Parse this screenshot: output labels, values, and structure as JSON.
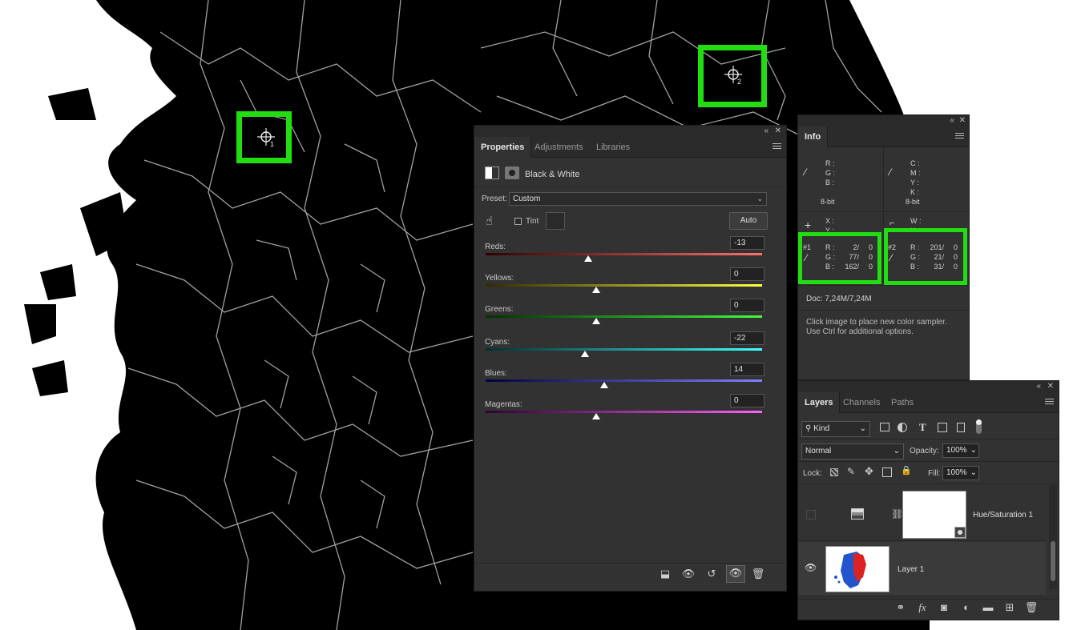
{
  "colors": {
    "accent": "#22dd11",
    "panel_bg": "#323232"
  },
  "map": {
    "sampler1_label": "1",
    "sampler2_label": "2"
  },
  "properties": {
    "tabs": [
      "Properties",
      "Adjustments",
      "Libraries"
    ],
    "adjustment_name": "Black & White",
    "preset_label": "Preset:",
    "preset_value": "Custom",
    "tint_label": "Tint",
    "auto_label": "Auto",
    "sliders": [
      {
        "label": "Reds:",
        "value": "-13",
        "colors": [
          "#300000",
          "#ff7070"
        ],
        "position": 0.37
      },
      {
        "label": "Yellows:",
        "value": "0",
        "colors": [
          "#302a00",
          "#ffff40"
        ],
        "position": 0.4
      },
      {
        "label": "Greens:",
        "value": "0",
        "colors": [
          "#003000",
          "#40ff40"
        ],
        "position": 0.4
      },
      {
        "label": "Cyans:",
        "value": "-22",
        "colors": [
          "#003030",
          "#40ffff"
        ],
        "position": 0.36
      },
      {
        "label": "Blues:",
        "value": "14",
        "colors": [
          "#000040",
          "#8080ff"
        ],
        "position": 0.43
      },
      {
        "label": "Magentas:",
        "value": "0",
        "colors": [
          "#300030",
          "#ff60ff"
        ],
        "position": 0.4
      }
    ]
  },
  "info": {
    "tab": "Info",
    "rgb_labels": [
      "R :",
      "G :",
      "B :"
    ],
    "cmyk_labels": [
      "C :",
      "M :",
      "Y :",
      "K :"
    ],
    "bit_left": "8-bit",
    "bit_right": "8-bit",
    "xy_labels": [
      "X :",
      "Y :"
    ],
    "wh_labels": [
      "W :",
      "H :"
    ],
    "sampler1": {
      "tag": "#1",
      "r": "2/",
      "r2": "0",
      "g": "77/",
      "g2": "0",
      "b": "162/",
      "b2": "0"
    },
    "sampler2": {
      "tag": "#2",
      "r": "201/",
      "r2": "0",
      "g": "21/",
      "g2": "0",
      "b": "31/",
      "b2": "0"
    },
    "doc": "Doc: 7,24M/7,24M",
    "hint_line1": "Click image to place new color sampler.",
    "hint_line2": "Use Ctrl for additional options."
  },
  "layers": {
    "tabs": [
      "Layers",
      "Channels",
      "Paths"
    ],
    "filter_kind": "Kind",
    "blend_mode": "Normal",
    "opacity_label": "Opacity:",
    "opacity_value": "100%",
    "lock_label": "Lock:",
    "fill_label": "Fill:",
    "fill_value": "100%",
    "items": [
      {
        "name": "Hue/Saturation 1",
        "visible": false
      },
      {
        "name": "Layer 1",
        "visible": true
      }
    ]
  }
}
